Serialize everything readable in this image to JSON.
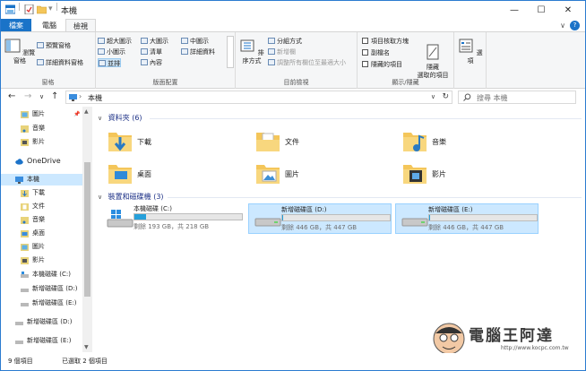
{
  "window": {
    "title": "本機",
    "separator": "|",
    "qa_dropdown": "▾",
    "minimize": "—",
    "maximize": "☐",
    "close": "✕"
  },
  "tabs": {
    "file": "檔案",
    "computer": "電腦",
    "view": "檢視",
    "collapse": "∨",
    "help": "?"
  },
  "ribbon": {
    "panes": {
      "nav_pane": "瀏覽窗格",
      "preview_pane": "預覽窗格",
      "details_pane": "詳細資料窗格",
      "group_label": "窗格"
    },
    "layout": {
      "extra_large": "超大圖示",
      "large": "大圖示",
      "medium": "中圖示",
      "small": "小圖示",
      "list": "清單",
      "details": "詳細資料",
      "tiles": "並排",
      "content": "內容",
      "group_label": "版面配置"
    },
    "current_view": {
      "sort_by": "排序方式",
      "group_by": "分組方式",
      "add_columns": "新增欄",
      "size_all_columns": "調整所有欄位至最適大小",
      "group_label": "目前檢視"
    },
    "show_hide": {
      "item_checkboxes": "項目核取方塊",
      "file_extensions": "副檔名",
      "hidden_items": "隱藏的項目",
      "hide_selected": "隱藏\n選取的項目",
      "group_label": "顯示/隱藏"
    },
    "options": "選項"
  },
  "nav": {
    "back": "←",
    "forward": "→",
    "recent": "∨",
    "up": "↑",
    "path_chevron": "›",
    "address": "本機",
    "address_dropdown": "∨",
    "refresh": "↻",
    "search_placeholder": "搜尋 本機"
  },
  "navpane": {
    "pin": "📌",
    "items": [
      {
        "label": "圖片",
        "icon": "pictures-folder-icon"
      },
      {
        "label": "音樂",
        "icon": "music-folder-icon"
      },
      {
        "label": "影片",
        "icon": "videos-folder-icon"
      },
      {
        "label": "OneDrive",
        "icon": "onedrive-icon"
      },
      {
        "label": "本機",
        "icon": "this-pc-icon"
      },
      {
        "label": "下載",
        "icon": "downloads-folder-icon"
      },
      {
        "label": "文件",
        "icon": "documents-folder-icon"
      },
      {
        "label": "音樂",
        "icon": "music-folder-icon"
      },
      {
        "label": "桌面",
        "icon": "desktop-folder-icon"
      },
      {
        "label": "圖片",
        "icon": "pictures-folder-icon"
      },
      {
        "label": "影片",
        "icon": "videos-folder-icon"
      },
      {
        "label": "本機磁碟 (C:)",
        "icon": "drive-icon"
      },
      {
        "label": "新增磁碟區 (D:)",
        "icon": "drive-icon"
      },
      {
        "label": "新增磁碟區 (E:)",
        "icon": "drive-icon"
      },
      {
        "label": "新增磁碟區 (D:)",
        "icon": "drive-icon"
      },
      {
        "label": "新增磁碟區 (E:)",
        "icon": "drive-icon"
      }
    ]
  },
  "content": {
    "folders_header": "資料夾 (6)",
    "folders": [
      {
        "label": "下載",
        "icon": "downloads-folder-icon"
      },
      {
        "label": "文件",
        "icon": "documents-folder-icon"
      },
      {
        "label": "音樂",
        "icon": "music-folder-icon"
      },
      {
        "label": "桌面",
        "icon": "desktop-folder-icon"
      },
      {
        "label": "圖片",
        "icon": "pictures-folder-icon"
      },
      {
        "label": "影片",
        "icon": "videos-folder-icon"
      }
    ],
    "drives_header": "裝置和磁碟機 (3)",
    "drives": [
      {
        "name": "本機磁碟 (C:)",
        "free": "剩餘 193 GB，共 218 GB",
        "used_fraction": 0.11,
        "selected": false
      },
      {
        "name": "新增磁碟區 (D:)",
        "free": "剩餘 446 GB，共 447 GB",
        "used_fraction": 0.003,
        "selected": true
      },
      {
        "name": "新增磁碟區 (E:)",
        "free": "剩餘 446 GB，共 447 GB",
        "used_fraction": 0.003,
        "selected": true
      }
    ]
  },
  "status": {
    "count": "9 個項目",
    "selected": "已選取 2 個項目"
  },
  "watermark": {
    "title": "電腦王阿達",
    "url": "http://www.kocpc.com.tw"
  },
  "colors": {
    "accent": "#1a73c8",
    "selection": "#cce8ff",
    "drive_fill": "#26a0da",
    "folder": "#f4c65a"
  }
}
